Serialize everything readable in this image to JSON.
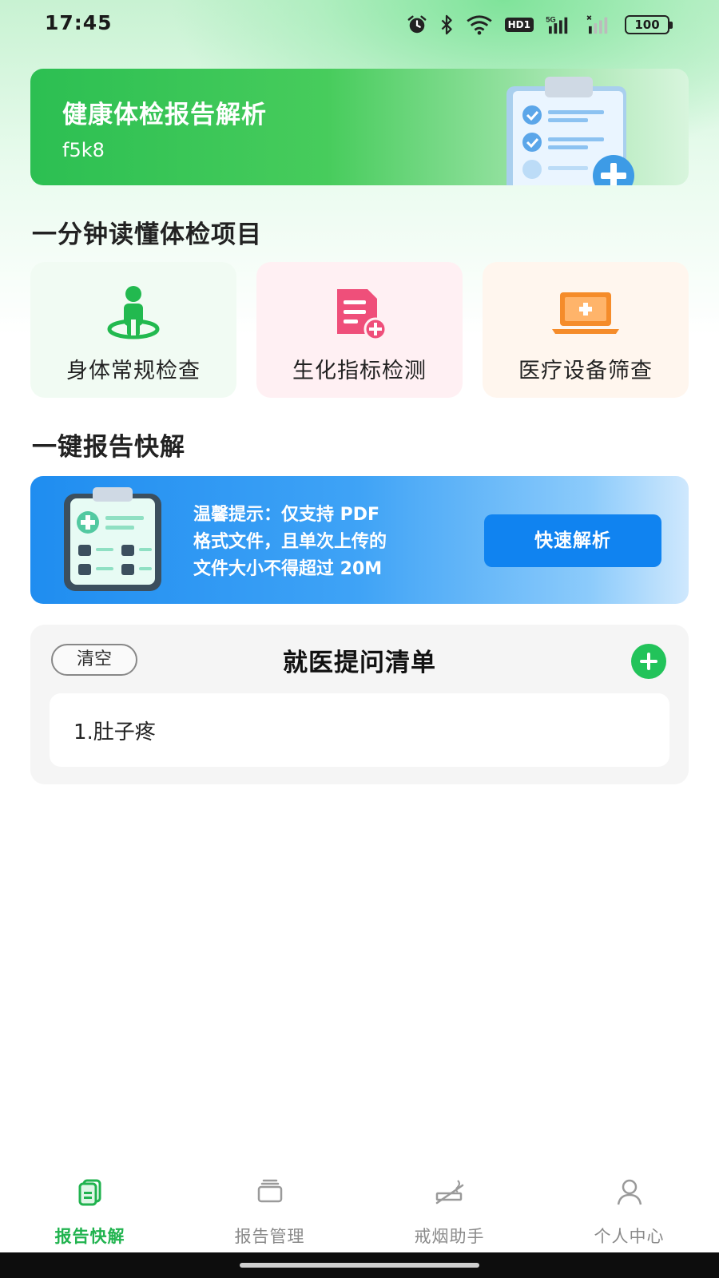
{
  "status_bar": {
    "time": "17:45",
    "icons": [
      "alarm-icon",
      "bluetooth-icon",
      "wifi-icon",
      "hd-icon",
      "signal-5g-icon",
      "signal-icon",
      "battery-icon"
    ],
    "hd_label": "HD1",
    "net_label": "5G",
    "battery": "100"
  },
  "hero": {
    "title": "健康体检报告解析",
    "subtitle": "f5k8",
    "illustration": "clipboard-checklist-icon"
  },
  "section_items": {
    "title": "一分钟读懂体检项目",
    "cards": [
      {
        "label": "身体常规检查",
        "icon": "person-location-icon",
        "bg": "#f1fbf3",
        "accent": "#22b94f"
      },
      {
        "label": "生化指标检测",
        "icon": "document-add-icon",
        "bg": "#fff0f3",
        "accent": "#ef4f7a"
      },
      {
        "label": "医疗设备筛查",
        "icon": "laptop-medical-icon",
        "bg": "#fff6ee",
        "accent": "#f58c2a"
      }
    ]
  },
  "section_quick": {
    "title": "一键报告快解",
    "tip_line1": "温馨提示：仅支持 PDF",
    "tip_line2": "格式文件，且单次上传的",
    "tip_line3": "文件大小不得超过 20M",
    "button": "快速解析"
  },
  "question_list": {
    "clear_label": "清空",
    "title": "就医提问清单",
    "items": [
      "1.肚子疼"
    ]
  },
  "bottom_nav": {
    "items": [
      {
        "label": "报告快解",
        "icon": "report-icon",
        "active": true
      },
      {
        "label": "报告管理",
        "icon": "folder-icon",
        "active": false
      },
      {
        "label": "戒烟助手",
        "icon": "no-smoking-icon",
        "active": false
      },
      {
        "label": "个人中心",
        "icon": "person-icon",
        "active": false
      }
    ]
  },
  "colors": {
    "brand_green": "#22b94f",
    "brand_blue": "#1083f0",
    "nav_inactive": "#8a8a8a"
  }
}
